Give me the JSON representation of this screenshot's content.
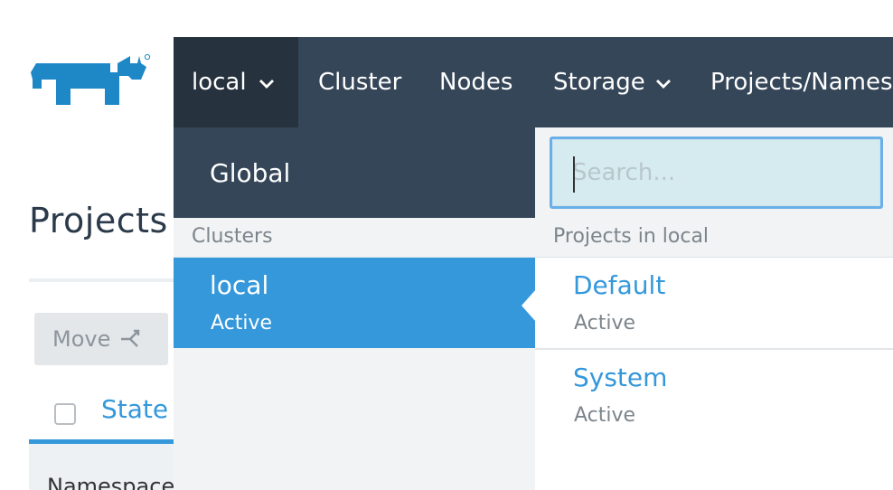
{
  "brand": {
    "logo_icon": "rancher-cow-logo-icon",
    "color": "#1e88c7"
  },
  "page": {
    "title": "Projects",
    "move_button": "Move",
    "columns": {
      "state": "State"
    },
    "group_label": "Namespace"
  },
  "nav": {
    "cluster_selector": "local",
    "items": [
      "Cluster",
      "Nodes",
      "Storage",
      "Projects/Names"
    ]
  },
  "dropdown": {
    "global_label": "Global",
    "clusters_header": "Clusters",
    "clusters": [
      {
        "name": "local",
        "status": "Active",
        "selected": true
      }
    ],
    "search": {
      "placeholder": "Search...",
      "value": ""
    },
    "projects_header": "Projects in local",
    "projects": [
      {
        "name": "Default",
        "status": "Active"
      },
      {
        "name": "System",
        "status": "Active"
      }
    ]
  },
  "colors": {
    "nav_bg": "#354658",
    "nav_active_bg": "#26323e",
    "accent": "#3498db"
  }
}
